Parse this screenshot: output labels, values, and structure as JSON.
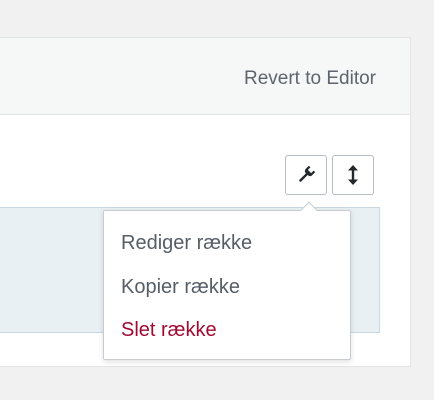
{
  "header": {
    "revert_label": "Revert to Editor"
  },
  "toolbar": {
    "settings_icon": "wrench-icon",
    "move_icon": "vertical-resize-icon"
  },
  "menu": {
    "items": [
      {
        "label": "Rediger række"
      },
      {
        "label": "Kopier række"
      },
      {
        "label": "Slet række",
        "color": "#a00a30"
      }
    ]
  },
  "colors": {
    "background": "#f1f1f1",
    "panel": "#ffffff",
    "row_highlight": "#e8f0f3",
    "danger": "#a00a30"
  }
}
